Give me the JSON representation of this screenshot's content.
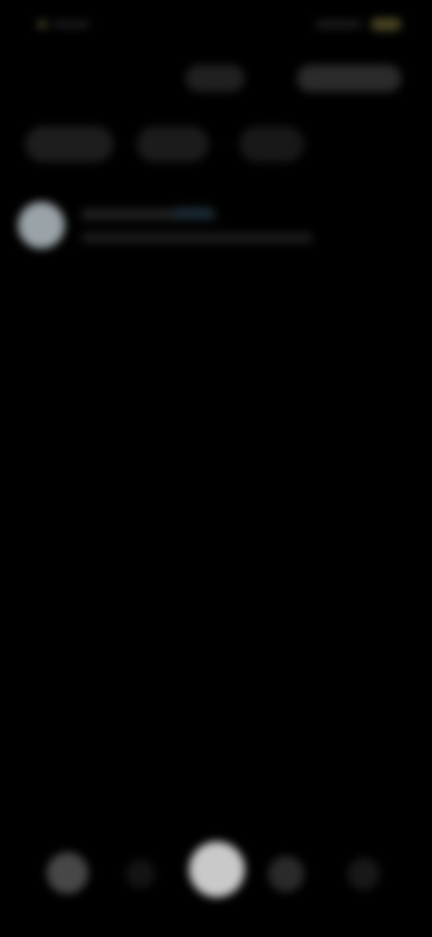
{
  "colors": {
    "background": "#000000",
    "accent_yellow": "#4a4523",
    "accent_blue": "#1a2a33",
    "avatar": "#9aa3a8",
    "home_button": "#c9c9c9"
  },
  "status_bar": {
    "time_icon": "dot-icon",
    "battery_icon": "battery-icon"
  },
  "header": {
    "button_a_icon": "chip-button",
    "button_b_icon": "chip-button"
  },
  "filters": {
    "icons": [
      "filter-chip",
      "filter-chip",
      "filter-chip"
    ]
  },
  "list": {
    "items": [
      {
        "avatar_icon": "avatar-icon"
      }
    ]
  },
  "bottom_nav": {
    "icons": [
      "nav-icon-1",
      "nav-icon-2",
      "home-icon",
      "nav-icon-4",
      "nav-icon-5"
    ]
  }
}
